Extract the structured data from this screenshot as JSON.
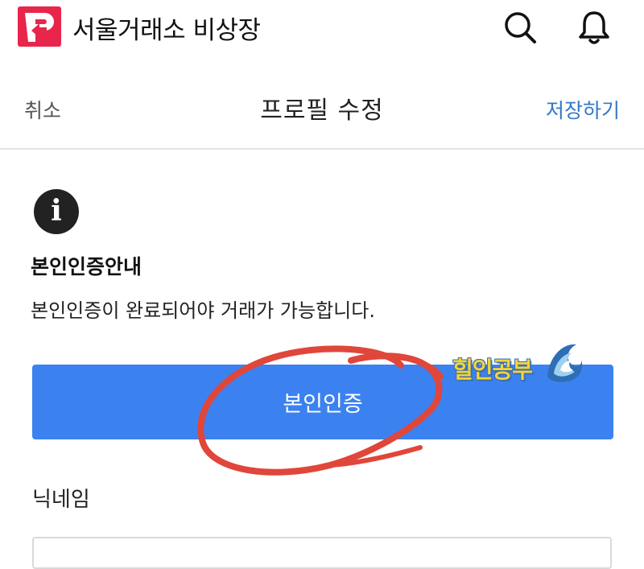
{
  "app_bar": {
    "title": "서울거래소 비상장",
    "logo_icon": "seoul-exchange-logo",
    "logo_color": "#e8264b",
    "search_icon": "search-icon",
    "notification_icon": "bell-icon"
  },
  "edit_header": {
    "cancel_label": "취소",
    "title": "프로필 수정",
    "save_label": "저장하기",
    "save_color": "#3478c8"
  },
  "notice": {
    "icon": "info-icon",
    "title": "본인인증안내",
    "text": "본인인증이 완료되어야 거래가 가능합니다."
  },
  "verify_button": {
    "label": "본인인증",
    "color": "#3b82f0"
  },
  "annotation": {
    "shape": "red-hand-drawn-ellipse",
    "color": "#e0463a"
  },
  "watermark": {
    "text": "힐인공부",
    "icon": "wave-icon"
  },
  "nickname": {
    "label": "닉네임",
    "value": "",
    "placeholder": ""
  }
}
